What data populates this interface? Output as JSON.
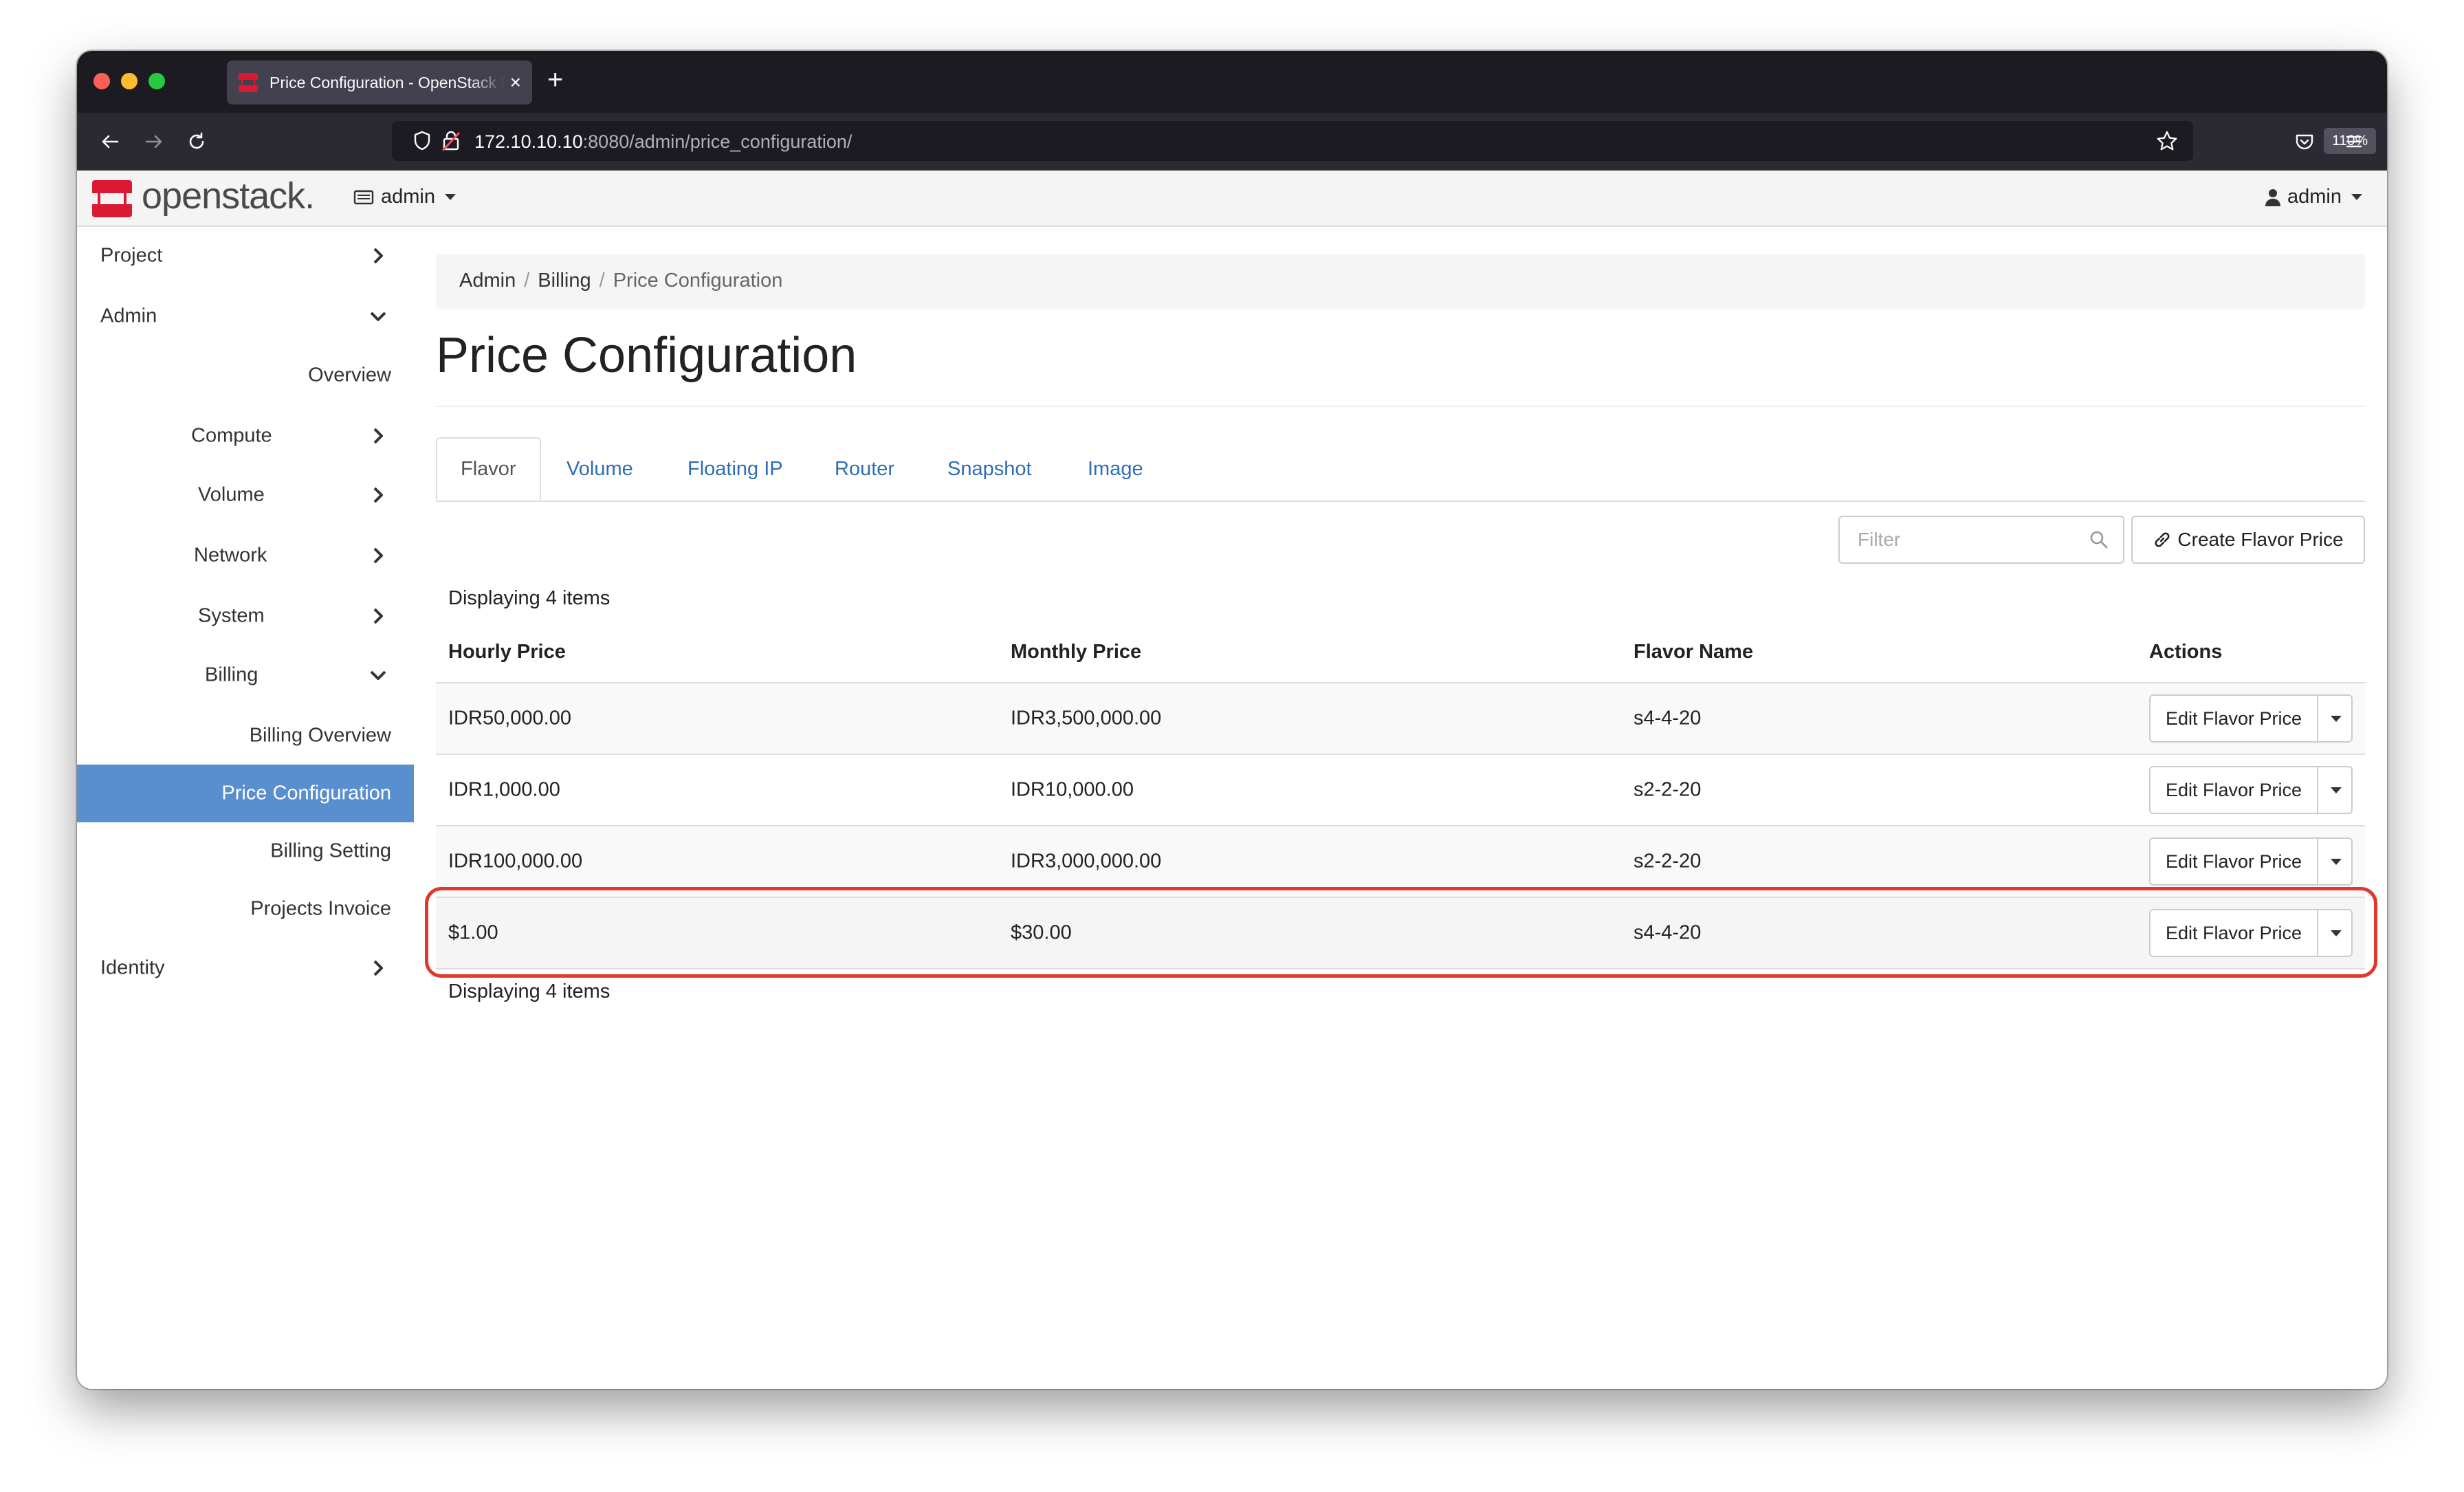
{
  "browser": {
    "tab_title": "Price Configuration - OpenStack Dashboard",
    "tab_close": "×",
    "new_tab": "+",
    "url_host": "172.10.10.10",
    "url_path": ":8080/admin/price_configuration/",
    "zoom": "110%"
  },
  "header": {
    "logo_text": "openstack.",
    "project": "admin",
    "user": "admin"
  },
  "sidebar": {
    "items": [
      {
        "label": "Project",
        "chevron": "right"
      },
      {
        "label": "Admin",
        "chevron": "down"
      },
      {
        "label": "Overview"
      },
      {
        "label": "Compute",
        "chevron": "right"
      },
      {
        "label": "Volume",
        "chevron": "right"
      },
      {
        "label": "Network",
        "chevron": "right"
      },
      {
        "label": "System",
        "chevron": "right"
      },
      {
        "label": "Billing",
        "chevron": "down"
      },
      {
        "label": "Billing Overview"
      },
      {
        "label": "Price Configuration",
        "active": true
      },
      {
        "label": "Billing Setting"
      },
      {
        "label": "Projects Invoice"
      },
      {
        "label": "Identity",
        "chevron": "right"
      }
    ]
  },
  "breadcrumb": [
    "Admin",
    "Billing",
    "Price Configuration"
  ],
  "breadcrumb_sep": "/",
  "page_title": "Price Configuration",
  "tabs": [
    {
      "label": "Flavor",
      "active": true
    },
    {
      "label": "Volume"
    },
    {
      "label": "Floating IP"
    },
    {
      "label": "Router"
    },
    {
      "label": "Snapshot"
    },
    {
      "label": "Image"
    }
  ],
  "filter": {
    "placeholder": "Filter",
    "value": ""
  },
  "create_button": "Create Flavor Price",
  "displaying_top": "Displaying 4 items",
  "displaying_bottom": "Displaying 4 items",
  "table": {
    "columns": [
      "Hourly Price",
      "Monthly Price",
      "Flavor Name",
      "Actions"
    ],
    "rows": [
      {
        "hourly": "IDR50,000.00",
        "monthly": "IDR3,500,000.00",
        "flavor": "s4-4-20",
        "action": "Edit Flavor Price"
      },
      {
        "hourly": "IDR1,000.00",
        "monthly": "IDR10,000.00",
        "flavor": "s2-2-20",
        "action": "Edit Flavor Price"
      },
      {
        "hourly": "IDR100,000.00",
        "monthly": "IDR3,000,000.00",
        "flavor": "s2-2-20",
        "action": "Edit Flavor Price"
      },
      {
        "hourly": "$1.00",
        "monthly": "$30.00",
        "flavor": "s4-4-20",
        "action": "Edit Flavor Price",
        "highlighted": true
      }
    ]
  },
  "colors": {
    "active_nav": "#5a8fcf",
    "link": "#2d6db5",
    "highlight_border": "#e0382b",
    "brand_red": "#da1a32"
  }
}
